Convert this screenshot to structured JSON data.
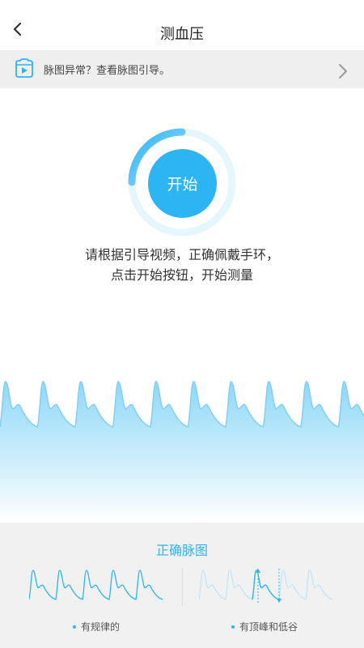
{
  "header": {
    "title": "测血压",
    "back_icon": "chevron-left-icon"
  },
  "banner": {
    "icon": "video-icon",
    "text": "脉图异常？查看脉图引导。",
    "chevron_icon": "chevron-right-icon"
  },
  "measure": {
    "start_label": "开始",
    "instruction_line1": "请根据引导视频，正确佩戴手环，",
    "instruction_line2": "点击开始按钮，开始测量",
    "accent_color": "#2cb4f3"
  },
  "guide": {
    "title": "正确脉图",
    "left_label": "有规律的",
    "right_label": "有顶峰和低谷"
  }
}
